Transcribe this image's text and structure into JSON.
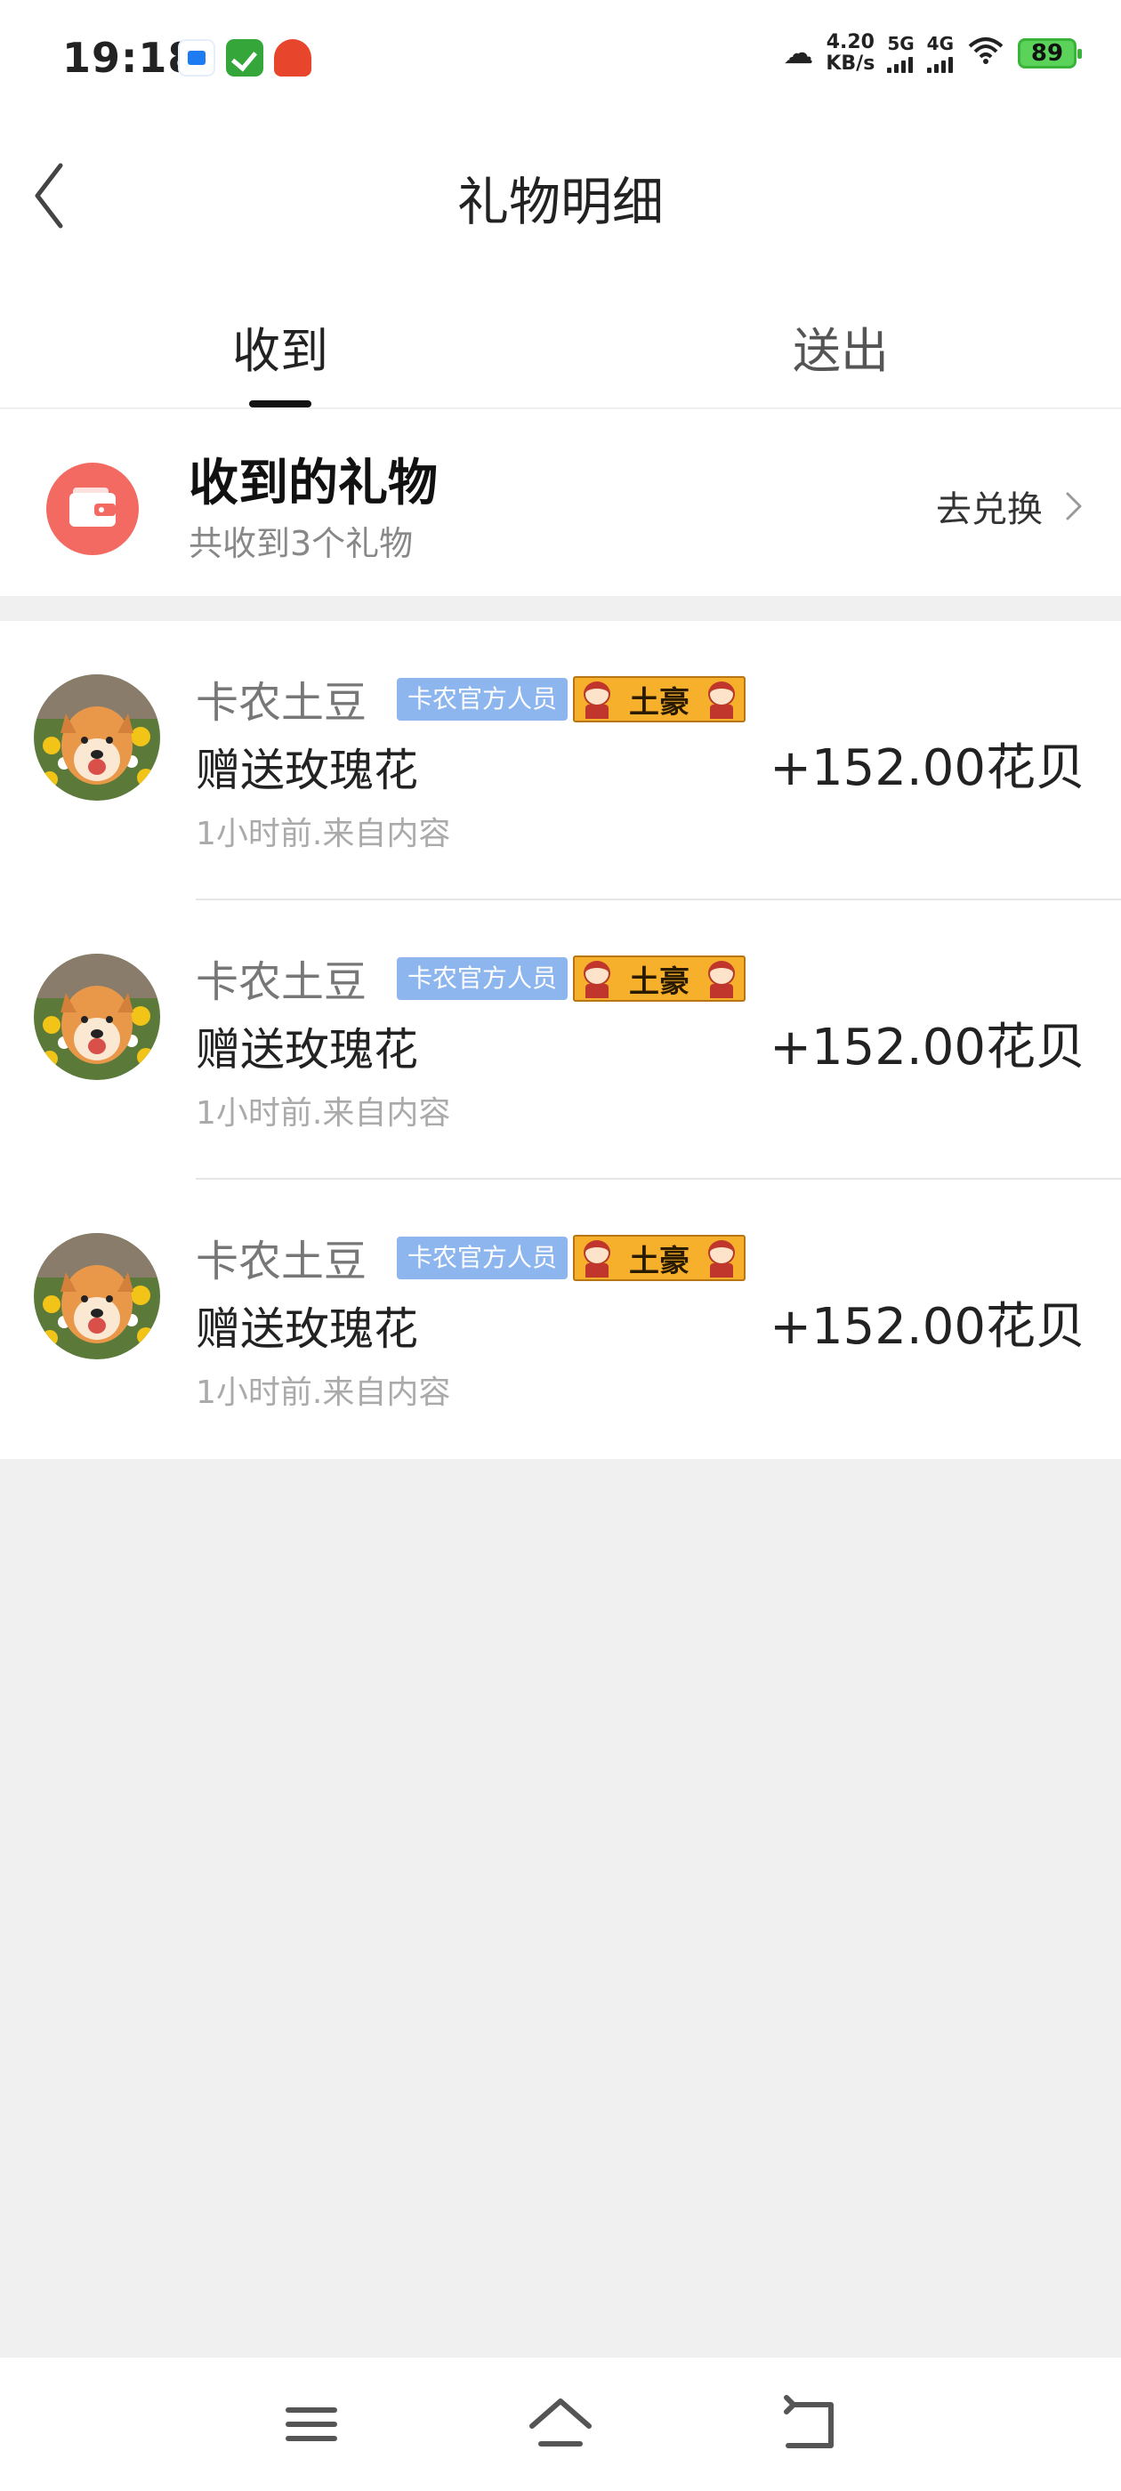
{
  "status_bar": {
    "time": "19:18",
    "speed_value": "4.20",
    "speed_unit": "KB/s",
    "network1": "5G",
    "network2": "4G",
    "battery": "89",
    "icons": [
      "blue-app-icon",
      "green-check-app-icon",
      "red-app-icon",
      "cloud-icon",
      "signal-icon",
      "wifi-icon",
      "battery-icon"
    ]
  },
  "header": {
    "title": "礼物明细",
    "back_icon": "chevron-left-icon"
  },
  "tabs": [
    {
      "label": "收到",
      "active": true
    },
    {
      "label": "送出",
      "active": false
    }
  ],
  "summary": {
    "title": "收到的礼物",
    "subtitle": "共收到3个礼物",
    "exchange_label": "去兑换",
    "icon": "wallet-icon",
    "icon_color": "#f26a62"
  },
  "gifts": [
    {
      "user": "卡农土豆",
      "badge": "卡农官方人员",
      "rank_badge": "土豪",
      "description": "赠送玫瑰花",
      "meta": "1小时前.来自内容",
      "amount": "+152.00花贝"
    },
    {
      "user": "卡农土豆",
      "badge": "卡农官方人员",
      "rank_badge": "土豪",
      "description": "赠送玫瑰花",
      "meta": "1小时前.来自内容",
      "amount": "+152.00花贝"
    },
    {
      "user": "卡农土豆",
      "badge": "卡农官方人员",
      "rank_badge": "土豪",
      "description": "赠送玫瑰花",
      "meta": "1小时前.来自内容",
      "amount": "+152.00花贝"
    }
  ],
  "nav_bar": {
    "icons": [
      "menu-icon",
      "home-icon",
      "back-icon"
    ]
  },
  "colors": {
    "background": "#f0f0f0",
    "official_badge": "#8eb6ee",
    "tuhao_badge": "#f6b02b"
  }
}
